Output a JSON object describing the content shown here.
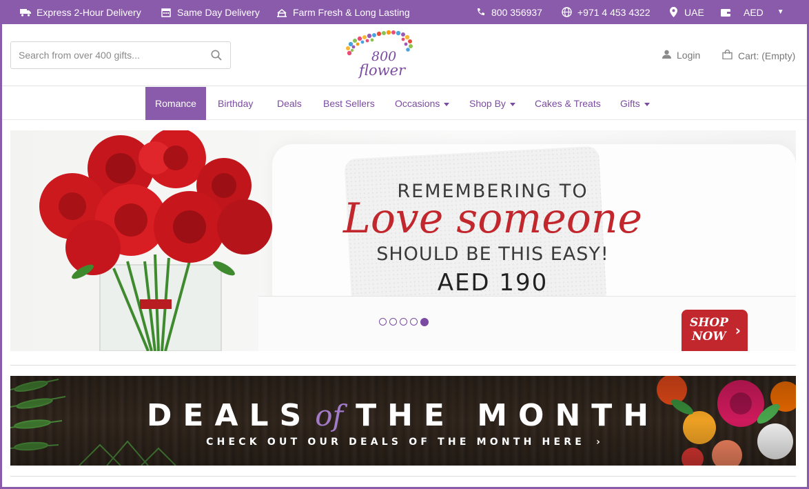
{
  "topbar": {
    "express": "Express 2-Hour Delivery",
    "same_day": "Same Day Delivery",
    "fresh": "Farm Fresh & Long Lasting",
    "phone": "800 356937",
    "intl_phone": "+971 4 453 4322",
    "country": "UAE",
    "currency": "AED",
    "bg_color": "#8a5aab"
  },
  "header": {
    "search_placeholder": "Search from over 400 gifts...",
    "logo_number": "800",
    "logo_word": "flower",
    "login": "Login",
    "cart": "Cart: (Empty)"
  },
  "nav": {
    "items": [
      {
        "label": "Romance",
        "active": true
      },
      {
        "label": "Birthday"
      },
      {
        "label": "Deals"
      },
      {
        "label": "Best Sellers"
      },
      {
        "label": "Occasions",
        "dropdown": true
      },
      {
        "label": "Shop By",
        "dropdown": true
      },
      {
        "label": "Cakes & Treats"
      },
      {
        "label": "Gifts",
        "dropdown": true
      }
    ]
  },
  "hero": {
    "line1": "REMEMBERING TO",
    "line2": "Love someone",
    "line3": "SHOULD BE THIS EASY!",
    "price": "AED 190",
    "cta_line1": "SHOP",
    "cta_line2": "NOW",
    "slides": 5,
    "active_slide": 5,
    "accent_red": "#c1272d"
  },
  "deals": {
    "word1": "DEALS",
    "word_of": "of",
    "word2": "THE MONTH",
    "subtitle": "CHECK OUT OUR DEALS OF THE MONTH HERE"
  }
}
